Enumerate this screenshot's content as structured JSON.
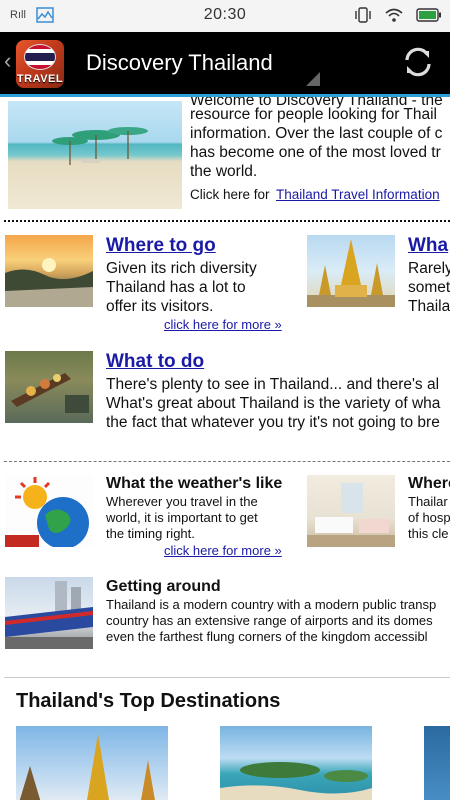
{
  "status_bar": {
    "signal_text": "Rıll",
    "time": "20:30"
  },
  "action_bar": {
    "app_icon_text": "TRAVEL",
    "title": "Discovery Thailand"
  },
  "intro": {
    "lines": [
      "Welcome to Discovery Thailand - the",
      "resource for people looking for Thail",
      "information. Over the last couple of c",
      "has become one of the most loved tr",
      "the world."
    ],
    "click_prefix": "Click here for",
    "link_text": "Thailand Travel Information"
  },
  "where_to_go": {
    "heading": "Where to go",
    "lines": [
      "Given its rich diversity",
      "Thailand has a lot to",
      "offer its visitors."
    ],
    "more": "click here for more »"
  },
  "what_right": {
    "heading": "Wha",
    "lines": [
      "Rarely",
      "somet",
      "Thaila"
    ]
  },
  "what_to_do": {
    "heading": "What to do",
    "lines": [
      "There's plenty to see in Thailand... and there's al",
      "What's great about Thailand is the variety of wha",
      "the fact that whatever you try it's not going to bre"
    ]
  },
  "weather": {
    "heading": "What the weather's like",
    "lines": [
      "Wherever you travel in the",
      "world, it is important to get",
      "the timing right."
    ],
    "more": "click here for more »"
  },
  "where_right": {
    "heading": "Where",
    "lines": [
      "Thailar",
      "of hosp",
      "this cle"
    ]
  },
  "getting_around": {
    "heading": "Getting around",
    "lines": [
      "Thailand is a modern country with a modern public transp",
      "country has an extensive range of airports and its domes",
      "even the farthest flung corners of the kingdom accessibl"
    ]
  },
  "top_destinations": {
    "heading": "Thailand's Top Destinations"
  },
  "colors": {
    "accent": "#2a9fd8",
    "link": "#1a1aa6",
    "action_bar": "#000000"
  }
}
